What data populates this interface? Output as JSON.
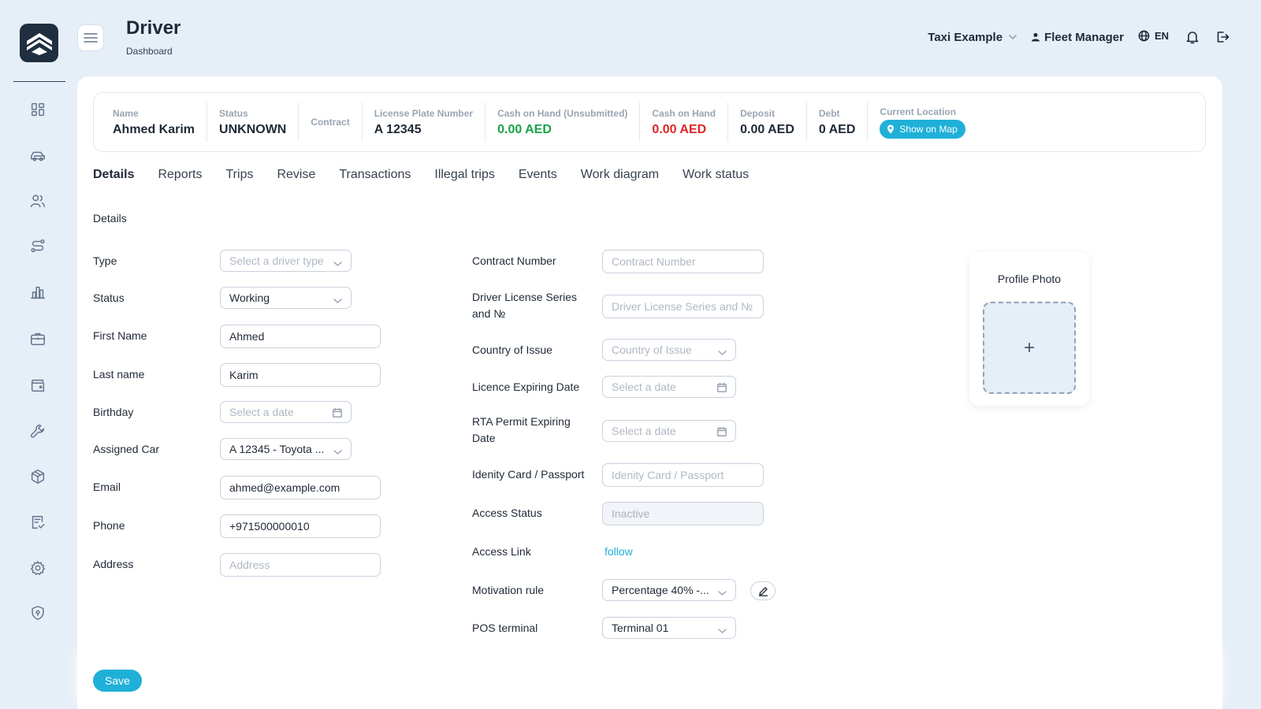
{
  "header": {
    "title": "Driver",
    "subtitle": "Dashboard",
    "company": "Taxi Example",
    "user": "Fleet Manager",
    "language": "EN"
  },
  "sidebar": {
    "items": [
      {
        "icon": "dashboard-icon"
      },
      {
        "icon": "car-icon"
      },
      {
        "icon": "users-icon"
      },
      {
        "icon": "route-icon"
      },
      {
        "icon": "chart-icon"
      },
      {
        "icon": "briefcase-icon"
      },
      {
        "icon": "wallet-icon"
      },
      {
        "icon": "wrench-icon"
      },
      {
        "icon": "box-icon"
      },
      {
        "icon": "checklist-icon"
      },
      {
        "icon": "settings-icon"
      },
      {
        "icon": "shield-icon"
      }
    ]
  },
  "summary": {
    "name_label": "Name",
    "name_value": "Ahmed Karim",
    "status_label": "Status",
    "status_value": "UNKNOWN",
    "contract_label": "Contract",
    "plate_label": "License Plate Number",
    "plate_value": "A 12345",
    "cash_unsub_label": "Cash on Hand (Unsubmitted)",
    "cash_unsub_value": "0.00 AED",
    "cash_label": "Cash on Hand",
    "cash_value": "0.00 AED",
    "deposit_label": "Deposit",
    "deposit_value": "0.00 AED",
    "debt_label": "Debt",
    "debt_value": "0 AED",
    "location_label": "Current Location",
    "map_button": "Show on Map"
  },
  "tabs": [
    "Details",
    "Reports",
    "Trips",
    "Revise",
    "Transactions",
    "Illegal trips",
    "Events",
    "Work diagram",
    "Work status"
  ],
  "section_title": "Details",
  "form_left": {
    "type": {
      "label": "Type",
      "placeholder": "Select a driver type"
    },
    "status": {
      "label": "Status",
      "value": "Working"
    },
    "first_name": {
      "label": "First Name",
      "value": "Ahmed"
    },
    "last_name": {
      "label": "Last name",
      "value": "Karim"
    },
    "birthday": {
      "label": "Birthday",
      "placeholder": "Select a date"
    },
    "assigned_car": {
      "label": "Assigned Car",
      "value": "A 12345 - Toyota ..."
    },
    "email": {
      "label": "Email",
      "value": "ahmed@example.com"
    },
    "phone": {
      "label": "Phone",
      "value": "+971500000010"
    },
    "address": {
      "label": "Address",
      "placeholder": "Address"
    }
  },
  "form_right": {
    "contract_number": {
      "label": "Contract Number",
      "placeholder": "Contract Number"
    },
    "license_series": {
      "label_line1": "Driver License Series",
      "label_line2": "and №",
      "placeholder": "Driver License Series and №"
    },
    "country": {
      "label": "Country of Issue",
      "placeholder": "Country of Issue"
    },
    "licence_expiry": {
      "label": "Licence Expiring Date",
      "placeholder": "Select a date"
    },
    "rta_expiry": {
      "label_line1": "RTA Permit Expiring",
      "label_line2": "Date",
      "placeholder": "Select a date"
    },
    "identity": {
      "label": "Idenity Card / Passport",
      "placeholder": "Idenity Card / Passport"
    },
    "access_status": {
      "label": "Access Status",
      "value": "Inactive"
    },
    "access_link": {
      "label": "Access Link",
      "link": "follow"
    },
    "motivation": {
      "label": "Motivation rule",
      "value": "Percentage 40% -..."
    },
    "pos": {
      "label": "POS terminal",
      "value": "Terminal 01"
    }
  },
  "photo": {
    "title": "Profile Photo",
    "add": "+"
  },
  "footer": {
    "save": "Save"
  },
  "colors": {
    "accent": "#1fb0d8",
    "positive": "#16a34a",
    "negative": "#dc2626",
    "background": "#e6eef8"
  }
}
